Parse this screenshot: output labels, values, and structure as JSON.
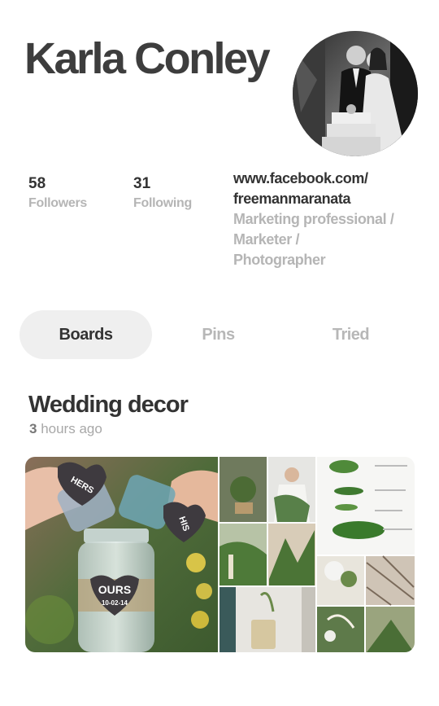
{
  "profile": {
    "name": "Karla Conley",
    "avatar_alt": "couple-wedding-photo",
    "followers_count": "58",
    "followers_label": "Followers",
    "following_count": "31",
    "following_label": "Following",
    "website": "www.facebook.com/\nfreemanmaranata",
    "about": "Marketing professional /\nMarketer /\nPhotographer"
  },
  "tabs": [
    {
      "label": "Boards",
      "active": true
    },
    {
      "label": "Pins",
      "active": false
    },
    {
      "label": "Tried",
      "active": false
    }
  ],
  "board": {
    "title": "Wedding decor",
    "time_count": "3",
    "time_rest": " hours ago",
    "main_image_text": "OURS",
    "main_image_date": "10-02-14",
    "tag_left": "HERS",
    "tag_right": "HIS"
  }
}
